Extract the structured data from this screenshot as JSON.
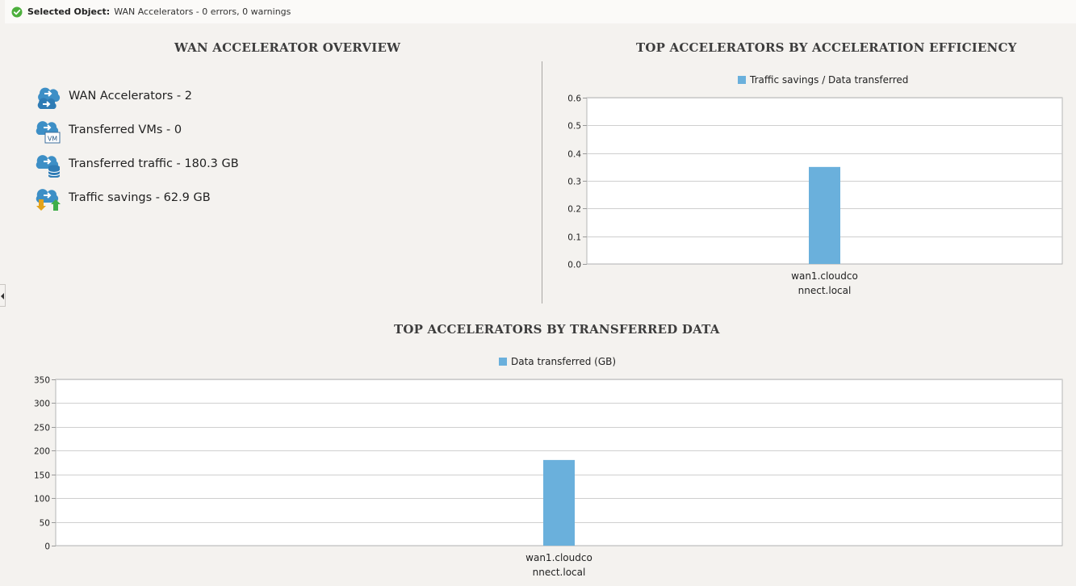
{
  "status": {
    "label": "Selected Object:",
    "value": "WAN Accelerators  - 0 errors, 0 warnings",
    "icon": "check-circle-icon",
    "color": "#4caf3c"
  },
  "overview": {
    "title": "WAN ACCELERATOR OVERVIEW",
    "items": [
      {
        "icon": "wan-accelerator-icon",
        "text": "WAN Accelerators - 2"
      },
      {
        "icon": "transferred-vms-icon",
        "text": "Transferred VMs - 0"
      },
      {
        "icon": "transferred-traffic-icon",
        "text": "Transferred traffic - 180.3 GB"
      },
      {
        "icon": "traffic-savings-icon",
        "text": "Traffic savings - 62.9 GB"
      }
    ]
  },
  "vm_badge": "VM",
  "colors": {
    "bar": "#6ab0dc",
    "grid": "#cfcfcf",
    "title": "#3d3d3d"
  },
  "chart_data": [
    {
      "type": "bar",
      "title": "TOP ACCELERATORS BY ACCELERATION EFFICIENCY",
      "legend": "Traffic savings / Data transferred",
      "legend_position": "top-center",
      "categories": [
        "wan1.cloudco nnect.local"
      ],
      "category_lines": [
        [
          "wan1.cloudco",
          "nnect.local"
        ]
      ],
      "series": [
        {
          "name": "Traffic savings / Data transferred",
          "values": [
            0.35
          ]
        }
      ],
      "ylim": [
        0,
        0.6
      ],
      "yticks": [
        "0.0",
        "0.1",
        "0.2",
        "0.3",
        "0.4",
        "0.5",
        "0.6"
      ],
      "grid": true
    },
    {
      "type": "bar",
      "title": "TOP ACCELERATORS BY TRANSFERRED DATA",
      "legend": "Data transferred (GB)",
      "legend_position": "top-center",
      "categories": [
        "wan1.cloudco nnect.local"
      ],
      "category_lines": [
        [
          "wan1.cloudco",
          "nnect.local"
        ]
      ],
      "series": [
        {
          "name": "Data transferred (GB)",
          "values": [
            180.3
          ]
        }
      ],
      "ylim": [
        0,
        350
      ],
      "yticks": [
        "0",
        "50",
        "100",
        "150",
        "200",
        "250",
        "300",
        "350"
      ],
      "grid": true
    }
  ]
}
